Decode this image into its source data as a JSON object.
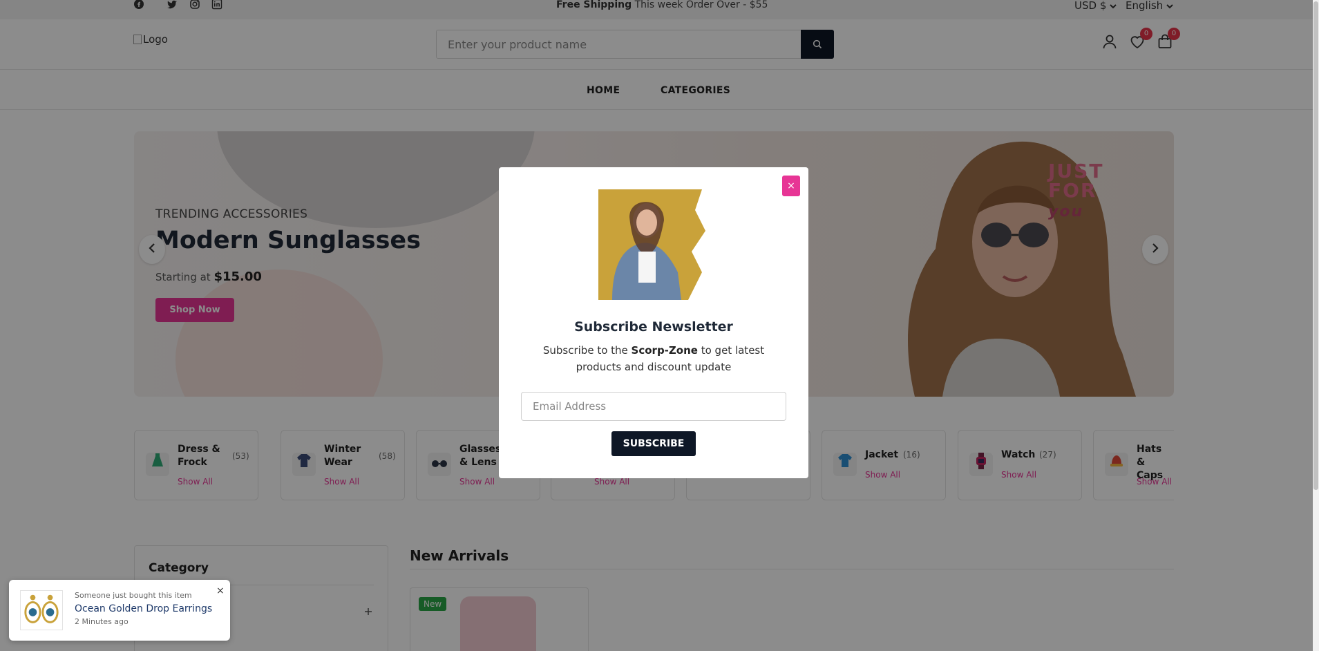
{
  "topbar": {
    "shipping_bold": "Free Shipping",
    "shipping_text": " This week Order Over - $55",
    "currency": "USD $",
    "language": "English",
    "social_icons": [
      "facebook-icon",
      "twitter-icon",
      "instagram-icon",
      "linkedin-icon"
    ]
  },
  "header": {
    "logo_alt": "Logo",
    "search_placeholder": "Enter your product name",
    "wishlist_count": "0",
    "cart_count": "0"
  },
  "nav": {
    "items": [
      {
        "label": "HOME"
      },
      {
        "label": "CATEGORIES"
      }
    ]
  },
  "hero": {
    "subtitle": "TRENDING ACCESSORIES",
    "title": "Modern Sunglasses",
    "price_prefix": "Starting at ",
    "price": "$15.00",
    "button": "Shop Now",
    "decor_text_1": "JUST",
    "decor_text_2": "FOR",
    "decor_text_3": "you"
  },
  "categories": [
    {
      "name": "Dress & Frock",
      "count": "(53)",
      "link": "Show All",
      "icon": "dress-icon"
    },
    {
      "name": "Winter Wear",
      "count": "(58)",
      "link": "Show All",
      "icon": "sweater-icon"
    },
    {
      "name": "Glasses & Lens",
      "count": "",
      "link": "Show All",
      "icon": "glasses-icon"
    },
    {
      "name": "",
      "count": "",
      "link": "Show All",
      "icon": ""
    },
    {
      "name": "",
      "count": "",
      "link": "",
      "icon": ""
    },
    {
      "name": "Jacket",
      "count": "(16)",
      "link": "Show All",
      "icon": "jacket-icon"
    },
    {
      "name": "Watch",
      "count": "(27)",
      "link": "Show All",
      "icon": "watch-icon"
    },
    {
      "name": "Hats & Caps",
      "count": "",
      "link": "Show All",
      "icon": "hat-icon"
    }
  ],
  "sidebar": {
    "title": "Category"
  },
  "new_arrivals": {
    "title": "New Arrivals",
    "badge": "New"
  },
  "modal": {
    "title": "Subscribe Newsletter",
    "text_before": "Subscribe to the ",
    "brand": "Scorp-Zone",
    "text_after": " to get latest products and discount update",
    "email_placeholder": "Email Address",
    "button": "SUBSCRIBE",
    "close": "×"
  },
  "toast": {
    "line1": "Someone just bought this item",
    "product": "Ocean Golden Drop Earrings",
    "time": "2 Minutes ago",
    "close": "×"
  },
  "colors": {
    "accent": "#e73595",
    "dark": "#0e1726",
    "badge": "#e8334a",
    "new_badge": "#28a745"
  }
}
